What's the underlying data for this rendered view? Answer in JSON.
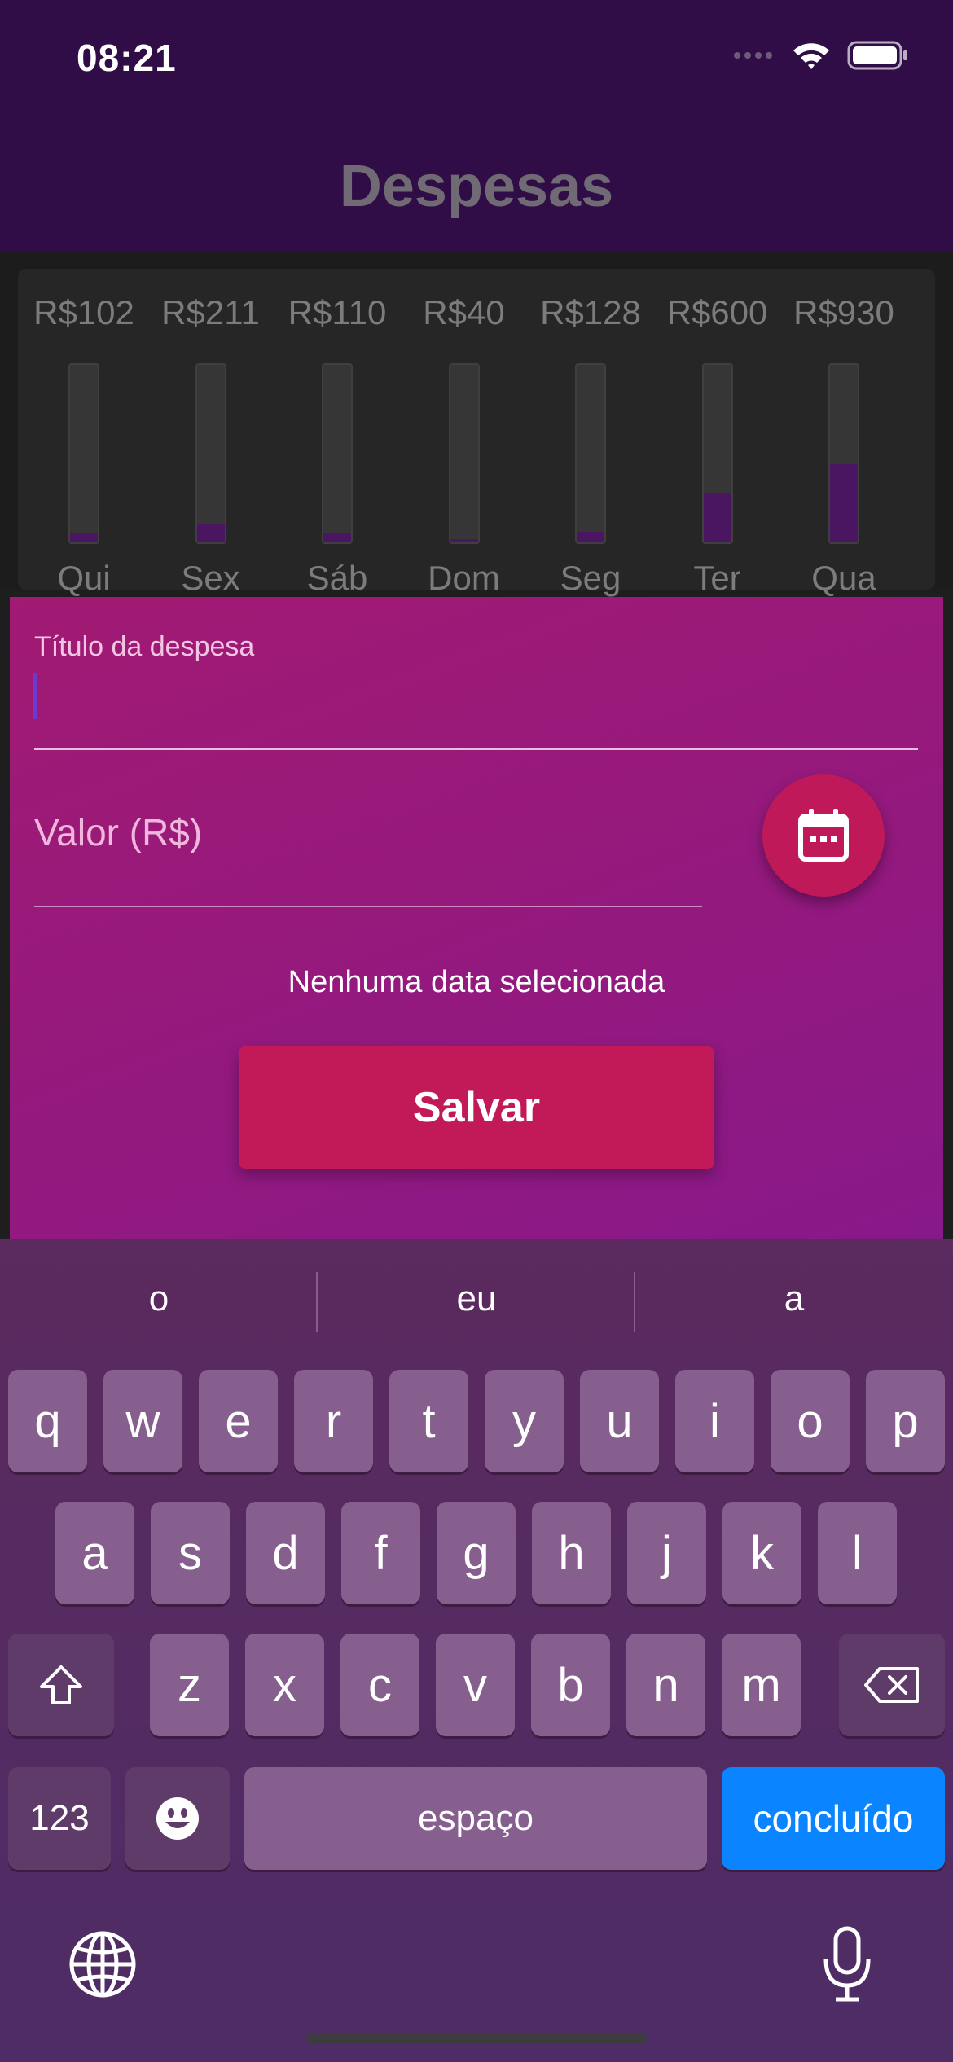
{
  "status_bar": {
    "time": "08:21"
  },
  "app_bar": {
    "title": "Despesas"
  },
  "chart_data": {
    "type": "bar",
    "categories": [
      "Qui",
      "Sex",
      "Sáb",
      "Dom",
      "Seg",
      "Ter",
      "Qua"
    ],
    "value_labels": [
      "R$102",
      "R$211",
      "R$110",
      "R$40",
      "R$128",
      "R$600",
      "R$930"
    ],
    "values": [
      102,
      211,
      110,
      40,
      128,
      600,
      930
    ],
    "fill_fractions": [
      0.05,
      0.1,
      0.05,
      0.02,
      0.06,
      0.28,
      0.44
    ]
  },
  "form": {
    "title_label": "Título da despesa",
    "value_label": "Valor (R$)",
    "no_date_text": "Nenhuma data selecionada",
    "save_label": "Salvar",
    "calendar_icon": "calendar-icon"
  },
  "keyboard": {
    "suggestions": [
      "o",
      "eu",
      "a"
    ],
    "row1": [
      "q",
      "w",
      "e",
      "r",
      "t",
      "y",
      "u",
      "i",
      "o",
      "p"
    ],
    "row2": [
      "a",
      "s",
      "d",
      "f",
      "g",
      "h",
      "j",
      "k",
      "l"
    ],
    "row3": [
      "z",
      "x",
      "c",
      "v",
      "b",
      "n",
      "m"
    ],
    "numbers_label": "123",
    "space_label": "espaço",
    "done_label": "concluído",
    "icons": [
      "shift-icon",
      "backspace-icon",
      "emoji-icon",
      "globe-icon",
      "microphone-icon"
    ]
  },
  "colors": {
    "app_bar": "#300d46",
    "bar_fill": "#4a1561",
    "form_gradient_start": "#a11a73",
    "form_gradient_end": "#88198a",
    "accent": "#c21958",
    "done_key": "#0a84ff"
  }
}
